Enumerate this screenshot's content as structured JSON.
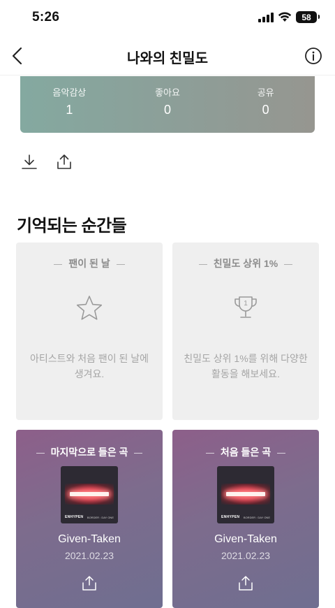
{
  "status_bar": {
    "time": "5:26",
    "battery": "58"
  },
  "header": {
    "title": "나와의 친밀도"
  },
  "stats": [
    {
      "label": "음악감상",
      "value": "1"
    },
    {
      "label": "좋아요",
      "value": "0"
    },
    {
      "label": "공유",
      "value": "0"
    }
  ],
  "section": {
    "title": "기억되는 순간들"
  },
  "cards": {
    "fan_day": {
      "title": "팬이 된 날",
      "description": "아티스트와 처음 팬이 된 날에 생겨요.",
      "icon": "star-icon"
    },
    "top_fan": {
      "title": "친밀도 상위 1%",
      "description": "친밀도 상위 1%를 위해 다양한 활동을 해보세요.",
      "icon": "trophy-icon"
    },
    "last_listened": {
      "title": "마지막으로 들은 곡",
      "song": "Given-Taken",
      "date": "2021.02.23",
      "album_brand": "ENHYPEN",
      "album_sub": "BORDER : DAY ONE"
    },
    "first_listened": {
      "title": "처음 들은 곡",
      "song": "Given-Taken",
      "date": "2021.02.23",
      "album_brand": "ENHYPEN",
      "album_sub": "BORDER : DAY ONE"
    }
  },
  "colors": {
    "stats_gradient_start": "#84a9a0",
    "stats_gradient_end": "#969690",
    "card_gray": "#efefef",
    "card_purple": "#7d6c8d"
  }
}
